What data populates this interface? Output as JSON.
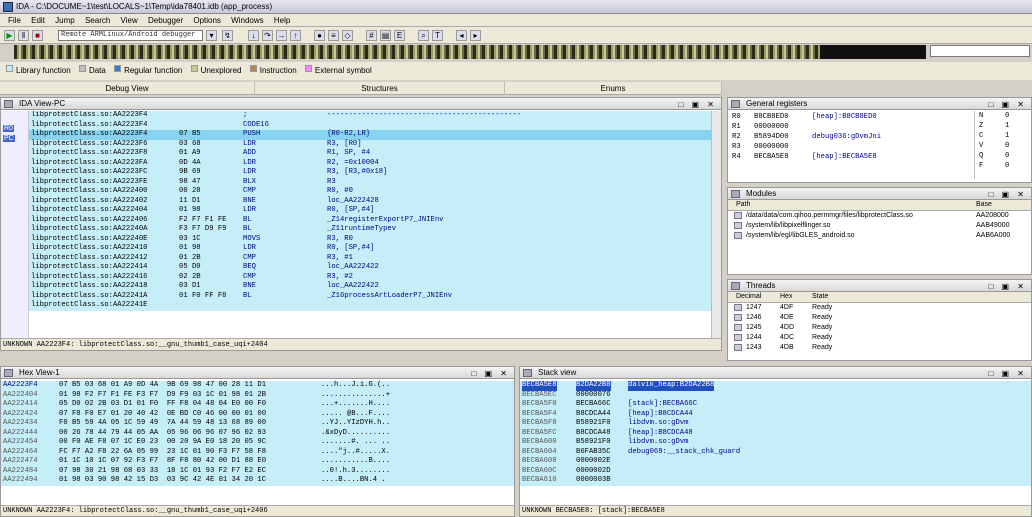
{
  "window": {
    "title": "IDA - C:\\DOCUME~1\\test\\LOCALS~1\\Temp\\ida78401.idb (app_process)"
  },
  "menu": [
    "File",
    "Edit",
    "Jump",
    "Search",
    "View",
    "Debugger",
    "Options",
    "Windows",
    "Help"
  ],
  "toolbar": {
    "debugger_select": "Remote ARMLinux/Android debugger"
  },
  "legend": [
    {
      "label": "Library function",
      "color": "#c5eef9"
    },
    {
      "label": "Data",
      "color": "#c0c0c0"
    },
    {
      "label": "Regular function",
      "color": "#2f7fd0"
    },
    {
      "label": "Unexplored",
      "color": "#c8c890"
    },
    {
      "label": "Instruction",
      "color": "#c08050"
    },
    {
      "label": "External symbol",
      "color": "#ff80ff"
    }
  ],
  "tabs": {
    "debug_view": "Debug View",
    "structures": "Structures",
    "enums": "Enums"
  },
  "ida_view": {
    "title": "IDA View-PC",
    "gutter_labels": [
      "R0",
      "PC"
    ],
    "rows": [
      {
        "addr": "libprotectClass.so:AA2223F4",
        "bytes": "",
        "mn": ";",
        "op": "---------------------------------------------"
      },
      {
        "addr": "libprotectClass.so:AA2223F4",
        "bytes": "",
        "mn": "CODE16",
        "op": ""
      },
      {
        "addr": "libprotectClass.so:AA2223F4",
        "bytes": "07 B5",
        "mn": "PUSH",
        "op": "{R0-R2,LR}"
      },
      {
        "addr": "libprotectClass.so:AA2223F6",
        "bytes": "03 68",
        "mn": "LDR",
        "op": "R3, [R0]"
      },
      {
        "addr": "libprotectClass.so:AA2223F8",
        "bytes": "01 A9",
        "mn": "ADD",
        "op": "R1, SP, #4"
      },
      {
        "addr": "libprotectClass.so:AA2223FA",
        "bytes": "0D 4A",
        "mn": "LDR",
        "op": "R2, =0x10004"
      },
      {
        "addr": "libprotectClass.so:AA2223FC",
        "bytes": "9B 69",
        "mn": "LDR",
        "op": "R3, [R3,#0x18]"
      },
      {
        "addr": "libprotectClass.so:AA2223FE",
        "bytes": "98 47",
        "mn": "BLX",
        "op": "R3"
      },
      {
        "addr": "libprotectClass.so:AA222400",
        "bytes": "00 28",
        "mn": "CMP",
        "op": "R0, #0"
      },
      {
        "addr": "libprotectClass.so:AA222402",
        "bytes": "11 D1",
        "mn": "BNE",
        "op": "loc_AA222428"
      },
      {
        "addr": "libprotectClass.so:AA222404",
        "bytes": "01 98",
        "mn": "LDR",
        "op": "R0, [SP,#4]"
      },
      {
        "addr": "libprotectClass.so:AA222406",
        "bytes": "F2 F7 F1 FE",
        "mn": "BL",
        "op": "_Z14registerExportP7_JNIEnv"
      },
      {
        "addr": "libprotectClass.so:AA22240A",
        "bytes": "F3 F7 D9 F9",
        "mn": "BL",
        "op": "_Z11runtimeTypev"
      },
      {
        "addr": "libprotectClass.so:AA22240E",
        "bytes": "03 1C",
        "mn": "MOVS",
        "op": "R3, R0"
      },
      {
        "addr": "libprotectClass.so:AA222410",
        "bytes": "01 98",
        "mn": "LDR",
        "op": "R0, [SP,#4]"
      },
      {
        "addr": "libprotectClass.so:AA222412",
        "bytes": "01 2B",
        "mn": "CMP",
        "op": "R3, #1"
      },
      {
        "addr": "libprotectClass.so:AA222414",
        "bytes": "05 D0",
        "mn": "BEQ",
        "op": "loc_AA222422"
      },
      {
        "addr": "libprotectClass.so:AA222416",
        "bytes": "02 2B",
        "mn": "CMP",
        "op": "R3, #2"
      },
      {
        "addr": "libprotectClass.so:AA222418",
        "bytes": "03 D1",
        "mn": "BNE",
        "op": "loc_AA222422"
      },
      {
        "addr": "libprotectClass.so:AA22241A",
        "bytes": "01 F0 FF F8",
        "mn": "BL",
        "op": "_Z16processArtLoaderP7_JNIEnv"
      },
      {
        "addr": "libprotectClass.so:AA22241E",
        "bytes": "",
        "mn": "",
        "op": ""
      }
    ],
    "status": "UNKNOWN AA2223F4: libprotectClass.so:__gnu_thumb1_case_uqi+2404"
  },
  "registers": {
    "title": "General registers",
    "rows": [
      {
        "name": "R0",
        "value": "B8CB8ED0",
        "note": "[heap]:B8CB8ED0"
      },
      {
        "name": "R1",
        "value": "00000000",
        "note": ""
      },
      {
        "name": "R2",
        "value": "B5894D00",
        "note": "debug036:gDvmJni"
      },
      {
        "name": "R3",
        "value": "00000000",
        "note": ""
      },
      {
        "name": "R4",
        "value": "BECBA5E8",
        "note": "[heap]:BECBA5E8"
      }
    ],
    "flags": [
      {
        "f": "N",
        "v": "0"
      },
      {
        "f": "Z",
        "v": "1"
      },
      {
        "f": "C",
        "v": "1"
      },
      {
        "f": "V",
        "v": "0"
      },
      {
        "f": "Q",
        "v": "0"
      },
      {
        "f": "F",
        "v": "0"
      }
    ]
  },
  "modules": {
    "title": "Modules",
    "col_path": "Path",
    "col_base": "Base",
    "rows": [
      {
        "path": "/data/data/com.qihoo.permmgr/files/libprotectClass.so",
        "base": "AA208000"
      },
      {
        "path": "/system/lib/libpixelflinger.so",
        "base": "AAB49000"
      },
      {
        "path": "/system/lib/egl/libGLES_android.so",
        "base": "AAB6A000"
      }
    ]
  },
  "threads": {
    "title": "Threads",
    "col_dec": "Decimal",
    "col_hex": "Hex",
    "col_state": "State",
    "rows": [
      {
        "dec": "1247",
        "hex": "4DF",
        "state": "Ready"
      },
      {
        "dec": "1246",
        "hex": "4DE",
        "state": "Ready"
      },
      {
        "dec": "1245",
        "hex": "4DD",
        "state": "Ready"
      },
      {
        "dec": "1244",
        "hex": "4DC",
        "state": "Ready"
      },
      {
        "dec": "1243",
        "hex": "4DB",
        "state": "Ready"
      }
    ]
  },
  "hexview": {
    "title": "Hex View-1",
    "rows": [
      {
        "addr": "AA2223F4",
        "bytes": "07 B5 03 68 01 A9 0D 4A  9B 69 98 47 00 28 11 D1",
        "ascii": "...h...J.i.G.(.."
      },
      {
        "addr": "AA222404",
        "bytes": "01 98 F2 F7 F1 FE F3 F7  D9 F9 03 1C 01 98 01 2B",
        "ascii": "...............+"
      },
      {
        "addr": "AA222414",
        "bytes": "05 D0 02 2B 03 D1 01 F0  FF F8 04 48 04 E0 00 F0",
        "ascii": "...+.......H...."
      },
      {
        "addr": "AA222424",
        "bytes": "07 F8 F0 E7 01 20 40 42  0E BD C0 46 00 00 01 00",
        "ascii": "..... @B...F...."
      },
      {
        "addr": "AA222434",
        "bytes": "F0 B5 59 4A 05 1C 59 49  7A 44 59 48 13 68 89 00",
        "ascii": "..YJ..YIzDYH.h.."
      },
      {
        "addr": "AA222444",
        "bytes": "00 26 78 44 79 44 05 AA  05 96 06 96 07 96 02 93",
        "ascii": ".&xDyD.........."
      },
      {
        "addr": "AA222454",
        "bytes": "00 F0 AE F8 07 1C E0 23  00 20 9A E0 18 20 05 9C",
        "ascii": ".......#. ... .."
      },
      {
        "addr": "AA222464",
        "bytes": "FC F7 A2 F8 22 6A 05 99  23 1C 01 90 F3 F7 58 F8",
        "ascii": "....\"j..#.....X."
      },
      {
        "addr": "AA222474",
        "bytes": "01 1C 10 1C 07 92 F3 F7  8F F8 80 42 00 D1 88 E0",
        "ascii": "...........B...."
      },
      {
        "addr": "AA222484",
        "bytes": "07 98 30 21 98 68 03 33  18 1C 01 93 F2 F7 E2 EC",
        "ascii": "..0!.h.3........"
      },
      {
        "addr": "AA222494",
        "bytes": "01 98 03 90 98 42 15 D3  03 9C 42 4E 01 34 20 1C",
        "ascii": "....B....BN.4 ."
      }
    ],
    "status": "UNKNOWN AA2223F4: libprotectClass.so:__gnu_thumb1_case_uqi+2406"
  },
  "stackview": {
    "title": "Stack view",
    "rows": [
      {
        "addr": "BECBA5E8",
        "val": "B2DA22B8",
        "note": "dalvik_heap:B2DA22B8",
        "hl": true
      },
      {
        "addr": "BECBA5EC",
        "val": "00000076",
        "note": ""
      },
      {
        "addr": "BECBA5F0",
        "val": "BECBA66C",
        "note": "[stack]:BECBA66C"
      },
      {
        "addr": "BECBA5F4",
        "val": "B8CDCA44",
        "note": "[heap]:B8CDCA44"
      },
      {
        "addr": "BECBA5F8",
        "val": "B58921F0",
        "note": "libdvm.so:gDvm"
      },
      {
        "addr": "BECBA5FC",
        "val": "B8CDCA48",
        "note": "[heap]:B8CDCA48"
      },
      {
        "addr": "BECBA600",
        "val": "B58921F0",
        "note": "libdvm.so:gDvm"
      },
      {
        "addr": "BECBA604",
        "val": "B6FAB35C",
        "note": "debug069:__stack_chk_guard"
      },
      {
        "addr": "BECBA608",
        "val": "0000002E",
        "note": ""
      },
      {
        "addr": "BECBA60C",
        "val": "0000002D",
        "note": ""
      },
      {
        "addr": "BECBA610",
        "val": "0000003B",
        "note": ""
      }
    ],
    "status": "UNKNOWN BECBA5E8: [stack]:BECBA5E8"
  }
}
